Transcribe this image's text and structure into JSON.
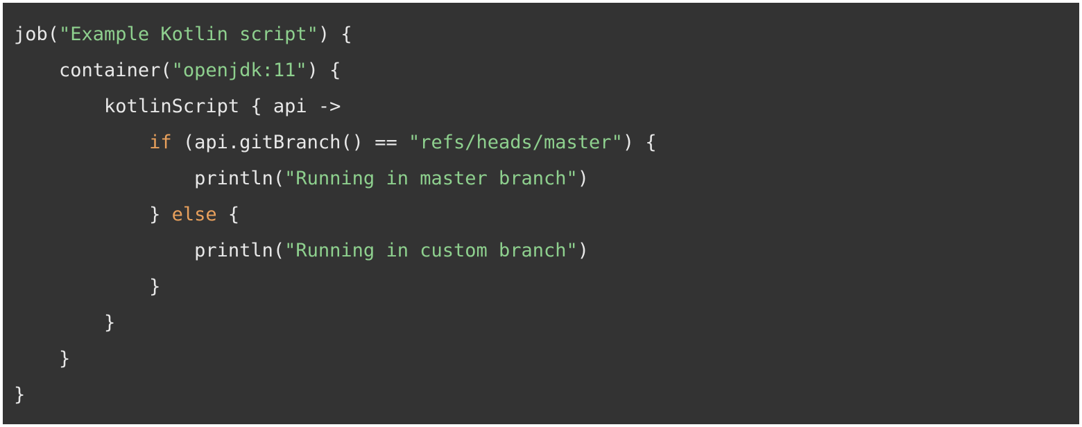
{
  "code": {
    "line1": {
      "t1": "job(",
      "s1": "\"Example Kotlin script\"",
      "t2": ") {"
    },
    "line2": {
      "indent": "    ",
      "t1": "container(",
      "s1": "\"openjdk:11\"",
      "t2": ") {"
    },
    "line3": {
      "indent": "        ",
      "t1": "kotlinScript { api ->"
    },
    "line4": {
      "indent": "            ",
      "k1": "if",
      "t1": " (api.gitBranch() == ",
      "s1": "\"refs/heads/master\"",
      "t2": ") {"
    },
    "line5": {
      "indent": "                ",
      "t1": "println(",
      "s1": "\"Running in master branch\"",
      "t2": ")"
    },
    "line6": {
      "indent": "            ",
      "t1": "} ",
      "k1": "else",
      "t2": " {"
    },
    "line7": {
      "indent": "                ",
      "t1": "println(",
      "s1": "\"Running in custom branch\"",
      "t2": ")"
    },
    "line8": {
      "indent": "            ",
      "t1": "}"
    },
    "line9": {
      "indent": "        ",
      "t1": "}"
    },
    "line10": {
      "indent": "    ",
      "t1": "}"
    },
    "line11": {
      "t1": "}"
    }
  }
}
